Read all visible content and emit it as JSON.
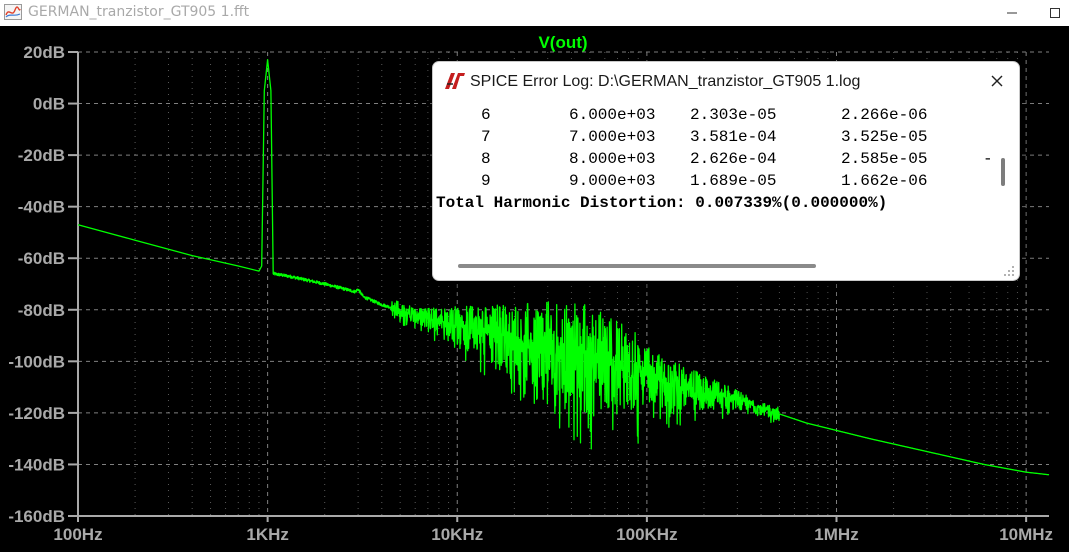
{
  "window": {
    "title": "GERMAN_tranzistor_GT905 1.fft",
    "minimize_glyph": "—",
    "maximize_glyph": "☐"
  },
  "plot": {
    "trace_name": "V(out)",
    "trace_color": "#00ff00",
    "background": "#000000",
    "axis_color": "#a9a9a9",
    "label_color": "#a9a9a9",
    "grid_color": "#808080"
  },
  "chart_data": {
    "type": "line",
    "title": "V(out)",
    "x_scale": "log",
    "xlim": [
      100,
      13200
    ],
    "ylim": [
      -160,
      20
    ],
    "x_ticks": [
      {
        "value": 100,
        "label": "100Hz"
      },
      {
        "value": 1000,
        "label": "1KHz"
      },
      {
        "value": 10000,
        "label": "10KHz"
      },
      {
        "value": 100000,
        "label": "100KHz"
      },
      {
        "value": 1000000,
        "label": "1MHz"
      },
      {
        "value": 10000000,
        "label": "10MHz"
      }
    ],
    "y_ticks": [
      {
        "value": 20,
        "label": "20dB"
      },
      {
        "value": 0,
        "label": "0dB"
      },
      {
        "value": -20,
        "label": "-20dB"
      },
      {
        "value": -40,
        "label": "-40dB"
      },
      {
        "value": -60,
        "label": "-60dB"
      },
      {
        "value": -80,
        "label": "-80dB"
      },
      {
        "value": -100,
        "label": "-100dB"
      },
      {
        "value": -120,
        "label": "-120dB"
      },
      {
        "value": -140,
        "label": "-140dB"
      },
      {
        "value": -160,
        "label": "-160dB"
      }
    ],
    "grid": true,
    "series": [
      {
        "name": "V(out)",
        "color": "#00ff00",
        "points": [
          [
            100,
            -47
          ],
          [
            200,
            -53
          ],
          [
            400,
            -59
          ],
          [
            700,
            -63
          ],
          [
            900,
            -65
          ],
          [
            930,
            -63
          ],
          [
            960,
            5
          ],
          [
            1000,
            17
          ],
          [
            1040,
            5
          ],
          [
            1070,
            -66
          ],
          [
            1300,
            -67
          ],
          [
            2000,
            -70
          ],
          [
            2900,
            -73
          ],
          [
            3000,
            -72
          ],
          [
            3200,
            -75
          ],
          [
            4000,
            -78
          ],
          [
            6000,
            -82
          ],
          [
            10000,
            -86
          ],
          [
            20000,
            -91
          ],
          [
            40000,
            -97
          ],
          [
            80000,
            -104
          ],
          [
            150000,
            -110
          ],
          [
            300000,
            -115
          ],
          [
            700000,
            -124
          ],
          [
            1500000,
            -130
          ],
          [
            3000000,
            -135
          ],
          [
            6000000,
            -140
          ],
          [
            10000000,
            -143
          ],
          [
            13200000,
            -144
          ]
        ],
        "noise_band": {
          "from_hz": 4500,
          "to_hz": 500000,
          "peak_spread_db": 22
        }
      }
    ]
  },
  "error_log": {
    "title": "SPICE Error Log: D:\\GERMAN_tranzistor_GT905 1.log",
    "rows": [
      {
        "n": "6",
        "freq": "6.000e+03",
        "a": "2.303e-05",
        "b": "2.266e-06",
        "mark": ""
      },
      {
        "n": "7",
        "freq": "7.000e+03",
        "a": "3.581e-04",
        "b": "3.525e-05",
        "mark": ""
      },
      {
        "n": "8",
        "freq": "8.000e+03",
        "a": "2.626e-04",
        "b": "2.585e-05",
        "mark": "-"
      },
      {
        "n": "9",
        "freq": "9.000e+03",
        "a": "1.689e-05",
        "b": "1.662e-06",
        "mark": ""
      }
    ],
    "thd": "Total Harmonic Distortion: 0.007339%(0.000000%)"
  },
  "icons": {
    "app": "ltspice-plot-icon",
    "log": "ltspice-logo-icon",
    "close": "close-icon"
  }
}
